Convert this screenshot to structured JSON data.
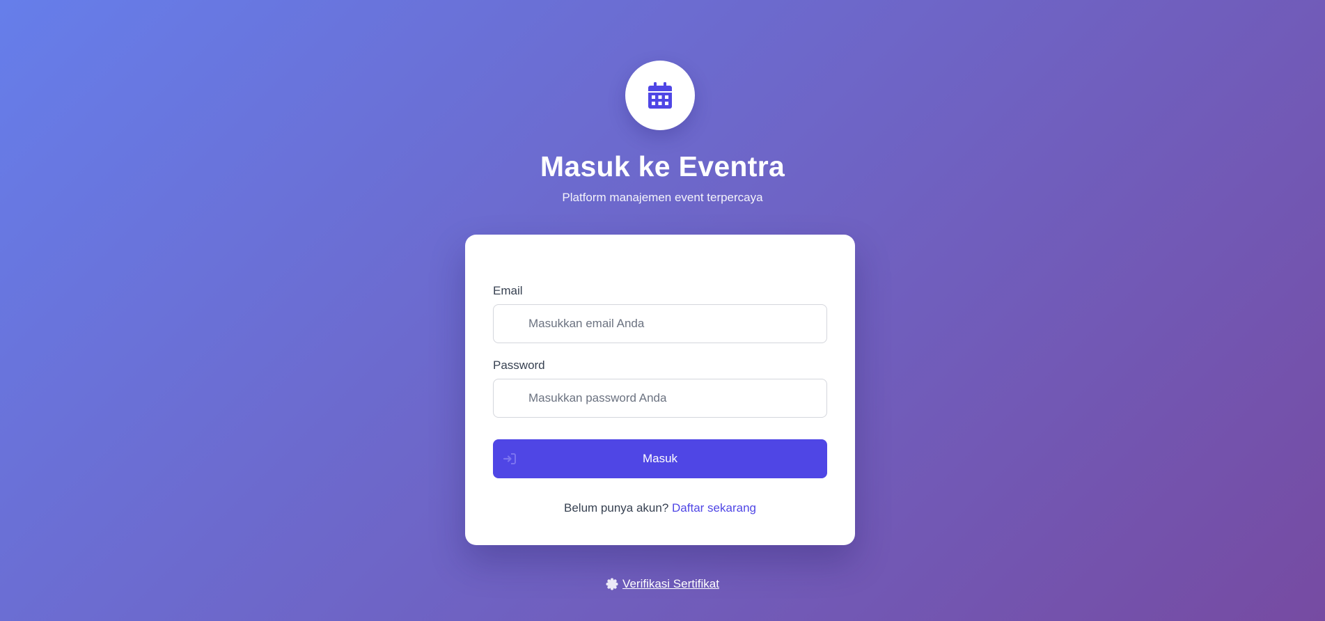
{
  "header": {
    "logo_icon": "calendar-icon",
    "title": "Masuk ke Eventra",
    "subtitle": "Platform manajemen event terpercaya"
  },
  "form": {
    "email": {
      "label": "Email",
      "placeholder": "Masukkan email Anda",
      "value": "",
      "icon": "envelope-icon"
    },
    "password": {
      "label": "Password",
      "placeholder": "Masukkan password Anda",
      "value": "",
      "icon": "lock-icon"
    },
    "submit": {
      "label": "Masuk",
      "icon": "sign-in-icon"
    },
    "register": {
      "prompt": "Belum punya akun?",
      "link_label": "Daftar sekarang"
    }
  },
  "footer": {
    "verify_label": "Verifikasi Sertifikat",
    "verify_icon": "certificate-icon"
  },
  "colors": {
    "background_start": "#667eea",
    "background_end": "#764ba2",
    "accent": "#4f46e5",
    "card": "#ffffff"
  }
}
